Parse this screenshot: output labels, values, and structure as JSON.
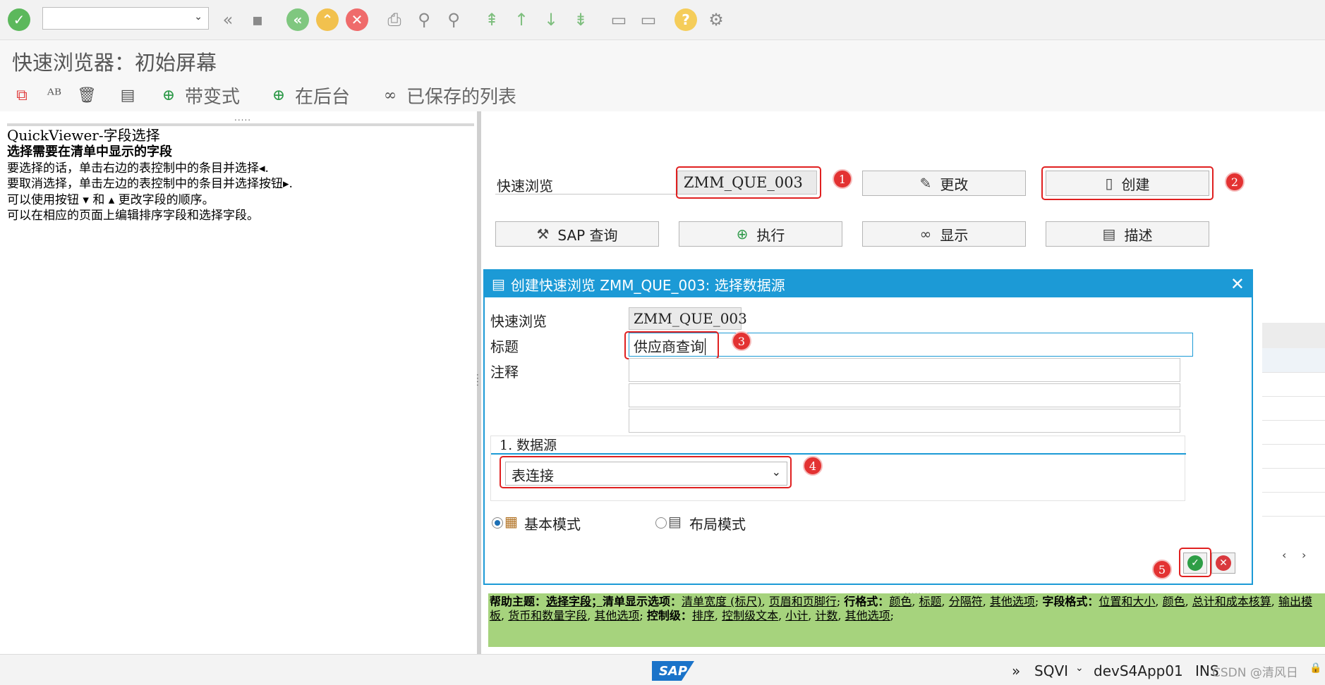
{
  "toolbar": {
    "command_field_value": "",
    "icons": [
      "enter-icon",
      "back-icon",
      "save-icon",
      "back-green-icon",
      "exit-icon",
      "cancel-icon",
      "print-icon",
      "find-icon",
      "find-next-icon",
      "first-page-icon",
      "prev-page-icon",
      "next-page-icon",
      "last-page-icon",
      "new-session-icon",
      "shortcut-icon",
      "help-icon",
      "settings-icon"
    ]
  },
  "page": {
    "title": "快速浏览器：初始屏幕"
  },
  "app_toolbar": {
    "items": [
      {
        "label": ""
      },
      {
        "label": ""
      },
      {
        "label": ""
      },
      {
        "label": ""
      },
      {
        "label": "带变式"
      },
      {
        "label": "在后台"
      },
      {
        "label": "已保存的列表"
      }
    ]
  },
  "help_panel": {
    "heading": "QuickViewer-字段选择",
    "subheading": "选择需要在清单中显示的字段",
    "line1": "要选择的话，单击右边的表控制中的条目并选择◂.",
    "line2": "要取消选择，单击左边的表控制中的条目并选择按钮▸.",
    "line3": "可以使用按钮 ▾ 和 ▴ 更改字段的顺序。",
    "line4": "可以在相应的页面上编辑排序字段和选择字段。"
  },
  "main": {
    "quickview_label": "快速浏览",
    "quickview_value": "ZMM_QUE_003",
    "change_button": "更改",
    "create_button": "创建",
    "sap_query_button": "SAP 查询",
    "execute_button": "执行",
    "display_button": "显示",
    "describe_button": "描述",
    "badges": [
      "1",
      "2",
      "3",
      "4",
      "5"
    ]
  },
  "dialog": {
    "title": "创建快速浏览 ZMM_QUE_003: 选择数据源",
    "quickview_label": "快速浏览",
    "quickview_value": "ZMM_QUE_003",
    "title_label": "标题",
    "title_value": "供应商查询",
    "comment_label": "注释",
    "comment_values": [
      "",
      "",
      ""
    ],
    "datasource_section": "1. 数据源",
    "datasource_value": "表连接",
    "mode_basic": "基本模式",
    "mode_layout": "布局模式",
    "mode_selected": "basic"
  },
  "help_strip": {
    "prefix": "帮助主题：",
    "select_fields": "选择字段；",
    "list_options": "清单显示选项：",
    "l1": "清单宽度 (标尺)",
    "l2": "页眉和页脚行",
    "row_format": "行格式：",
    "l3": "颜色",
    "l4": "标题",
    "l5": "分隔符",
    "l6": "其他选项",
    "field_format": "字段格式：",
    "l7": "位置和大小",
    "l8": "颜色",
    "l9": "总计和成本核算",
    "l10": "输出模板",
    "l11": "货币和数量字段",
    "l12": "其他选项",
    "control_level": "控制级：",
    "l13": "排序",
    "l14": "控制级文本",
    "l15": "小计",
    "l16": "计数",
    "l17": "其他选项"
  },
  "status_bar": {
    "logo": "SAP",
    "tcode": "SQVI",
    "server": "devS4App01",
    "mode": "INS",
    "watermark": "CSDN @清风日"
  },
  "colors": {
    "dialog_accent": "#1c9ad6",
    "help_strip": "#a6d37d",
    "highlight": "#e02020"
  }
}
